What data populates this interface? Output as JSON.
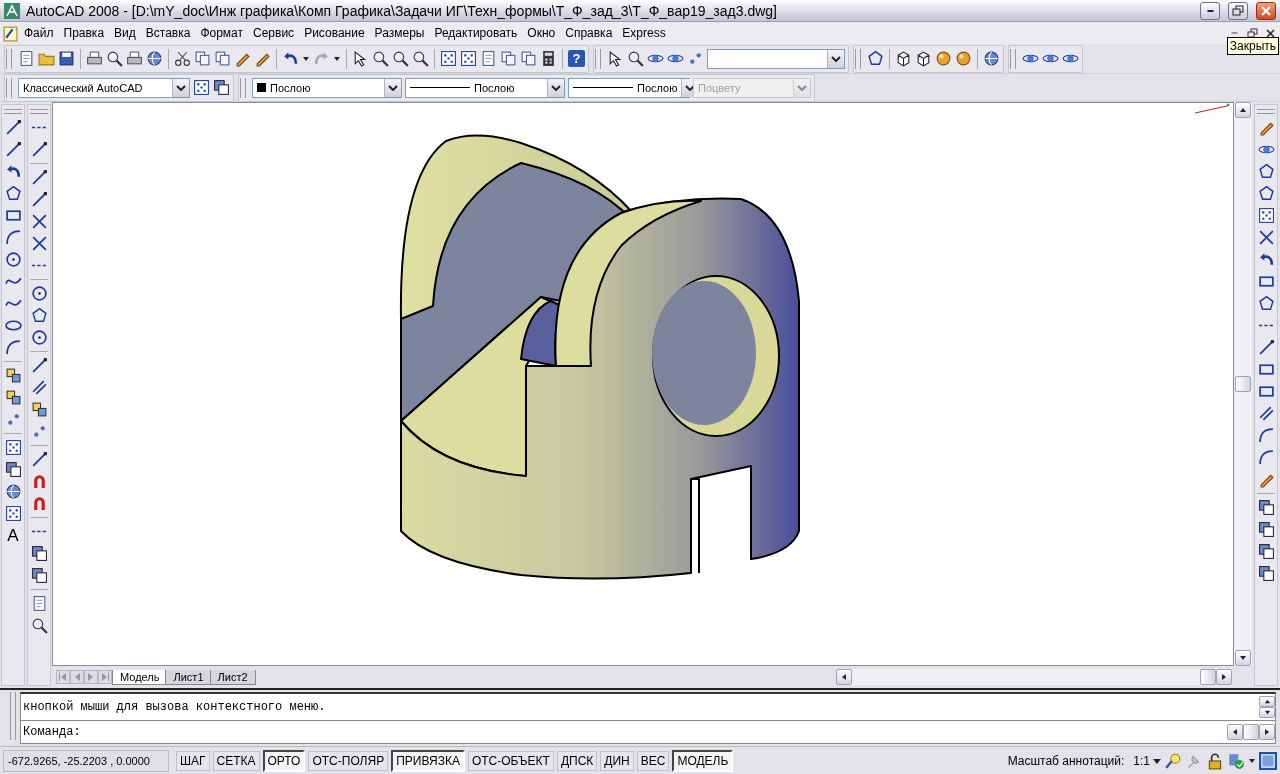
{
  "window": {
    "title": "AutoCAD 2008 - [D:\\mY_doc\\Инж графика\\Комп Графика\\Задачи ИГ\\Техн_формы\\Т_Ф_зад_3\\Т_Ф_вар19_зад3.dwg]"
  },
  "menu": [
    "Файл",
    "Правка",
    "Вид",
    "Вставка",
    "Формат",
    "Сервис",
    "Рисование",
    "Размеры",
    "Редактировать",
    "Окно",
    "Справка",
    "Express"
  ],
  "tooltip": "Закрыть",
  "standard_toolbar": {
    "help_label": "?"
  },
  "workspace_toolbar": {
    "workspace": "Классический AutoCAD"
  },
  "properties_toolbar": [
    {
      "kind": "color",
      "value": "Послою",
      "disabled": false
    },
    {
      "kind": "linetype",
      "value": "Послою",
      "disabled": false
    },
    {
      "kind": "linetype",
      "value": "Послою",
      "disabled": false
    },
    {
      "kind": "plain",
      "value": "Поцвету",
      "disabled": true
    }
  ],
  "draw_toolbar": {
    "text_tool_label": "A"
  },
  "layout_tabs": [
    {
      "label": "Модель",
      "selected": true
    },
    {
      "label": "Лист1",
      "selected": false
    },
    {
      "label": "Лист2",
      "selected": false
    }
  ],
  "command_window": {
    "history": [
      "кнопкой мыши для вызова контекстного меню."
    ],
    "prompt": "Команда:"
  },
  "status_bar": {
    "coordinates": "-672.9265, -25.2203 , 0.0000",
    "toggles": [
      {
        "label": "ШАГ",
        "on": false
      },
      {
        "label": "СЕТКА",
        "on": false
      },
      {
        "label": "ОРТО",
        "on": true
      },
      {
        "label": "ОТС-ПОЛЯР",
        "on": false
      },
      {
        "label": "ПРИВЯЗКА",
        "on": true
      },
      {
        "label": "ОТС-ОБЪЕКТ",
        "on": false
      },
      {
        "label": "ДПСК",
        "on": false
      },
      {
        "label": "ДИН",
        "on": false
      },
      {
        "label": "ВЕС",
        "on": false
      },
      {
        "label": "МОДЕЛЬ",
        "on": true
      }
    ],
    "annotation_scale_label": "Масштаб аннотаций:",
    "annotation_scale": "1:1"
  }
}
